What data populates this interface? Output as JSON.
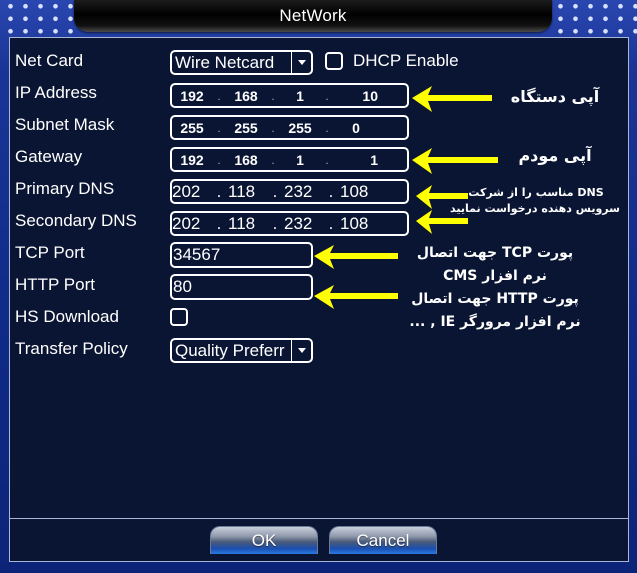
{
  "window": {
    "title": "NetWork"
  },
  "form": {
    "net_card": {
      "label": "Net Card",
      "value": "Wire Netcard"
    },
    "dhcp": {
      "label": "DHCP Enable",
      "checked": false
    },
    "ip_address": {
      "label": "IP Address",
      "octets": [
        "192",
        "168",
        "1",
        "10"
      ]
    },
    "subnet_mask": {
      "label": "Subnet Mask",
      "octets": [
        "255",
        "255",
        "255",
        "0"
      ]
    },
    "gateway": {
      "label": "Gateway",
      "octets": [
        "192",
        "168",
        "1",
        "1"
      ]
    },
    "primary_dns": {
      "label": "Primary DNS",
      "octets": [
        "202",
        "118",
        "232",
        "108"
      ]
    },
    "secondary_dns": {
      "label": "Secondary DNS",
      "octets": [
        "202",
        "118",
        "232",
        "108"
      ]
    },
    "tcp_port": {
      "label": "TCP Port",
      "value": "34567"
    },
    "http_port": {
      "label": "HTTP Port",
      "value": "80"
    },
    "hs_download": {
      "label": "HS Download",
      "checked": false
    },
    "transfer_policy": {
      "label": "Transfer Policy",
      "value": "Quality Preferr"
    }
  },
  "annotations": {
    "device_ip": "آپی دستگاه",
    "modem_ip": "آپی مودم",
    "dns_line1": "DNS مناسب را از شرکت",
    "dns_line2": "سرویس دهنده درخواست نمایید",
    "tcp_line1": "پورت TCP جهت اتصال",
    "tcp_line2": "نرم افزار CMS",
    "http_line1": "پورت HTTP جهت اتصال",
    "http_line2": "نرم افزار مرورگر IE , ..."
  },
  "buttons": {
    "ok": "OK",
    "cancel": "Cancel"
  },
  "colors": {
    "panel_bg": "#0a1533",
    "frame_blue": "#0f2a86",
    "arrow_yellow": "#ffff00"
  }
}
